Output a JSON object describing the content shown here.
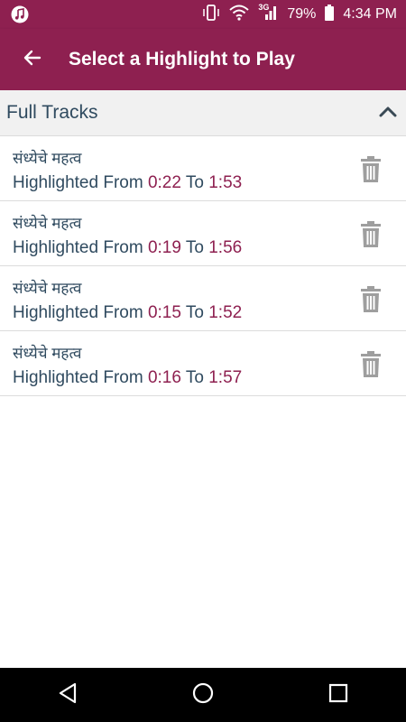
{
  "status_bar": {
    "battery": "79%",
    "time": "4:34 PM",
    "network": "3G",
    "icons": [
      "music-note-icon",
      "vibrate-icon",
      "wifi-icon",
      "signal-icon",
      "battery-icon"
    ]
  },
  "app_bar": {
    "title": "Select a Highlight to Play",
    "back_icon": "arrow-left-icon"
  },
  "section": {
    "title": "Full Tracks",
    "collapse_icon": "chevron-up-icon"
  },
  "labels": {
    "from": "Highlighted From ",
    "to": " To "
  },
  "tracks": [
    {
      "title": "संध्येचे महत्व",
      "from": "0:22",
      "to": "1:53"
    },
    {
      "title": "संध्येचे महत्व",
      "from": "0:19",
      "to": "1:56"
    },
    {
      "title": "संध्येचे महत्व",
      "from": "0:15",
      "to": "1:52"
    },
    {
      "title": "संध्येचे महत्व",
      "from": "0:16",
      "to": "1:57"
    }
  ],
  "nav": [
    "back-triangle-icon",
    "home-circle-icon",
    "recents-square-icon"
  ],
  "colors": {
    "primary": "#8e2050",
    "text": "#2f4a5f",
    "header_bg": "#f1f1f1",
    "icon_gray": "#9e9e9e"
  }
}
